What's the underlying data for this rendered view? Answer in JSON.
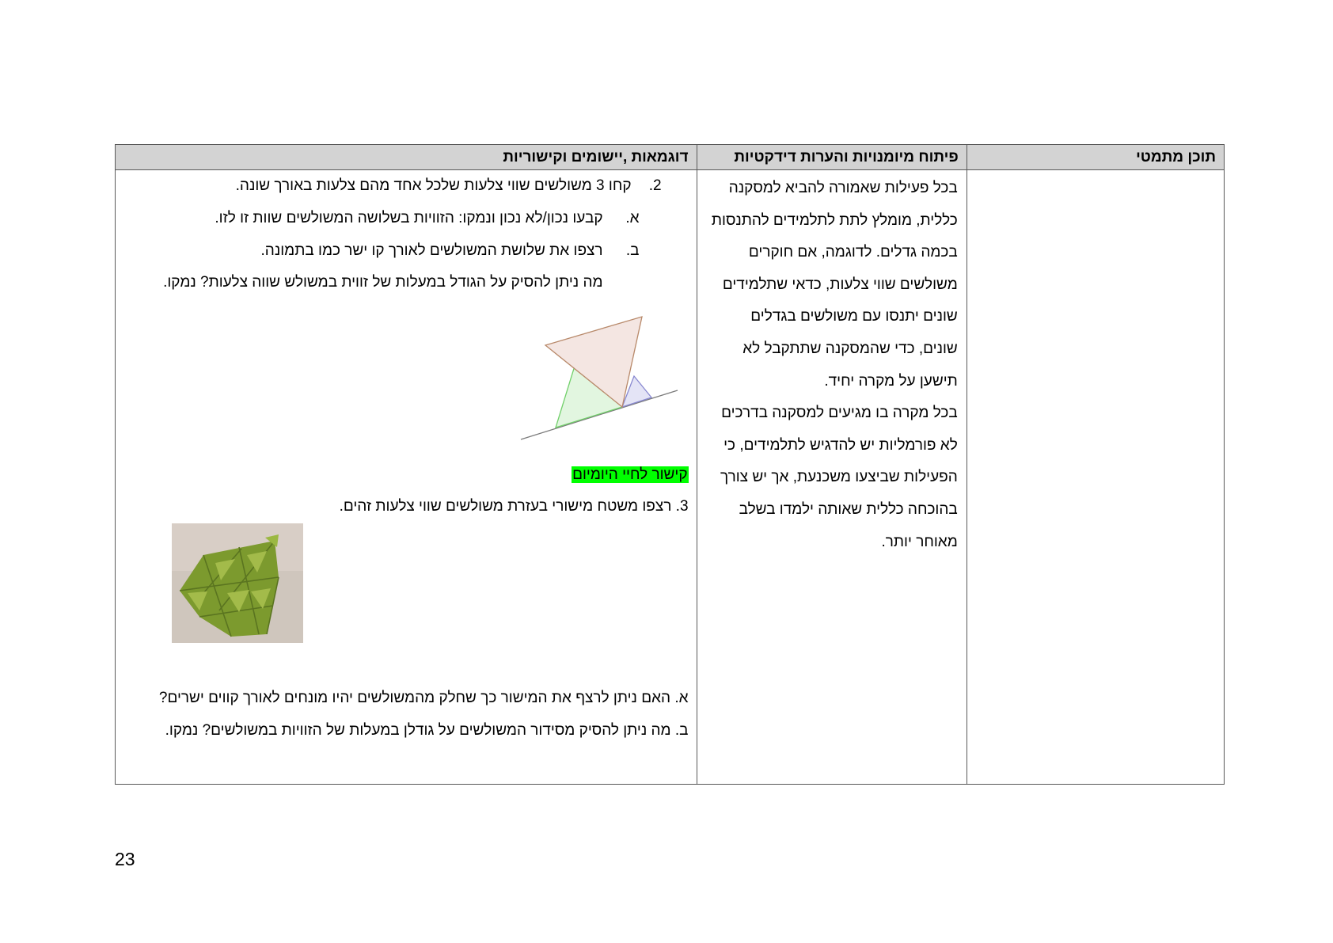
{
  "table": {
    "headers": {
      "content": "תוכן מתמטי",
      "didactic": "פיתוח מיומנויות והערות דידקטיות",
      "examples": "דוגמאות ,יישומים וקישוריות"
    },
    "didactic_lines": [
      "בכל פעילות שאמורה להביא למסקנה",
      "כללית, מומלץ לתת לתלמידים להתנסות",
      "בכמה גדלים. לדוגמה, אם חוקרים",
      "משולשים שווי צלעות, כדאי שתלמידים",
      "שונים יתנסו עם משולשים בגדלים",
      "שונים, כדי שהמסקנה שתתקבל לא",
      "תישען על מקרה יחיד.",
      "בכל מקרה בו מגיעים למסקנה בדרכים",
      "לא פורמליות יש להדגיש לתלמידים, כי",
      "הפעילות שביצעו משכנעת, אך יש צורך",
      "בהוכחה כללית שאותה ילמדו בשלב",
      "מאוחר יותר."
    ],
    "examples": {
      "item2_number": "2.",
      "item2_text": "קחו 3 משולשים שווי צלעות שלכל אחד מהם צלעות באורך שונה.",
      "item2a_letter": "א.",
      "item2a_text": "קבעו נכון/לא נכון ונמקו: הזוויות בשלושה המשולשים שוות זו לזו.",
      "item2b_letter": "ב.",
      "item2b_text": "רצפו את שלושת המשולשים לאורך קו ישר כמו בתמונה.",
      "item2b_cont": "מה ניתן להסיק על הגודל במעלות של זווית במשולש שווה צלעות? נמקו.",
      "link_label": "קישור לחיי היומיום",
      "item3_text": "3. רצפו משטח מישורי בעזרת משולשים שווי צלעות זהים.",
      "item3a_text": "א. האם ניתן לרצף את המישור כך שחלק מהמשולשים יהיו מונחים לאורך קווים ישרים?",
      "item3b_text": "ב. מה ניתן להסיק מסידור המשולשים על גודלן במעלות של הזוויות  במשולשים? נמקו."
    }
  },
  "page_number": "23",
  "colors": {
    "header_bg": "#d3d3d3",
    "highlight": "#00ff00",
    "tri_large_fill": "#f4e6e2",
    "tri_large_stroke": "#b8896a",
    "tri_green_fill": "#e2f6e0",
    "tri_green_stroke": "#71d06a",
    "tri_blue_fill": "#e4e4f6",
    "tri_blue_stroke": "#8888d0",
    "tile_green": "#8faa3c"
  }
}
